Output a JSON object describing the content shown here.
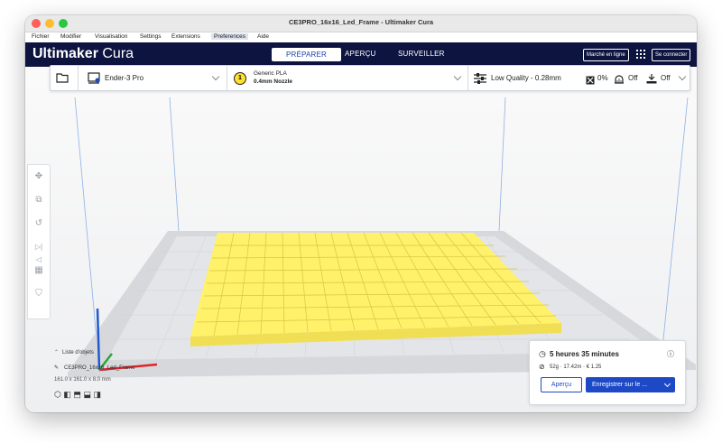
{
  "window": {
    "title": "CE3PRO_16x16_Led_Frame - Ultimaker Cura"
  },
  "menu": [
    "Fichier",
    "Modifier",
    "Visualisation",
    "Settings",
    "Extensions",
    "Preferences",
    "Aide"
  ],
  "header": {
    "logo_bold": "Ultimaker",
    "logo_light": " Cura",
    "stages": [
      "PRÉPARER",
      "APERÇU",
      "SURVEILLER"
    ],
    "marketplace": "Marché en ligne",
    "signin": "Se connecter"
  },
  "toolbar": {
    "printer": "Ender-3 Pro",
    "material_name": "Generic PLA",
    "nozzle": "0.4mm Nozzle",
    "extruder_number": "1",
    "profile": "Low Quality - 0.28mm",
    "infill": "0%",
    "support": "Off",
    "adhesion": "Off"
  },
  "objects": {
    "header": "Liste d'objets",
    "file": "CE3PRO_16x16_Led_Frame",
    "dimensions": "161.0 x 161.0 x 8.0 mm"
  },
  "print_info": {
    "time": "5 heures 35 minutes",
    "details": "52g · 17.42m · € 1.25",
    "preview_label": "Aperçu",
    "save_label": "Enregistrer sur le ..."
  },
  "colors": {
    "header": "#0e1440",
    "accent": "#1d49c6",
    "model": "#fff16a",
    "build_plate": "#dcdee2"
  }
}
